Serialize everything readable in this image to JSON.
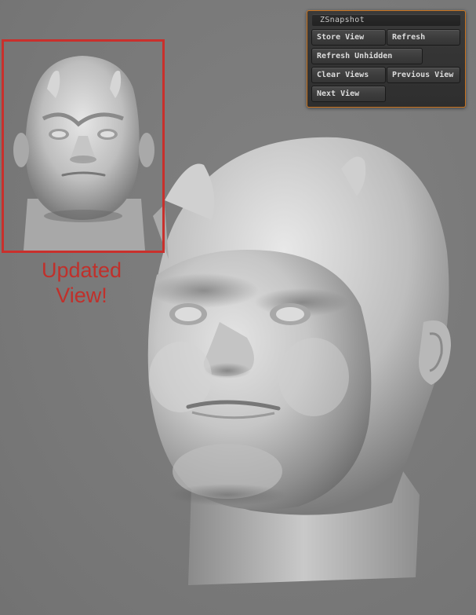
{
  "panel": {
    "title": "ZSnapshot",
    "buttons": {
      "store_view": "Store View",
      "refresh": "Refresh",
      "refresh_unhidden": "Refresh Unhidden",
      "clear_views": "Clear Views",
      "previous_view": "Previous View",
      "next_view": "Next View"
    },
    "accent_color": "#c8731f"
  },
  "annotation": {
    "line1": "Updated",
    "line2": "View!",
    "color": "#c9302c"
  },
  "icons": {
    "thumbnail": "head-sculpt-front-view",
    "viewport": "head-sculpt-three-quarter-view"
  }
}
